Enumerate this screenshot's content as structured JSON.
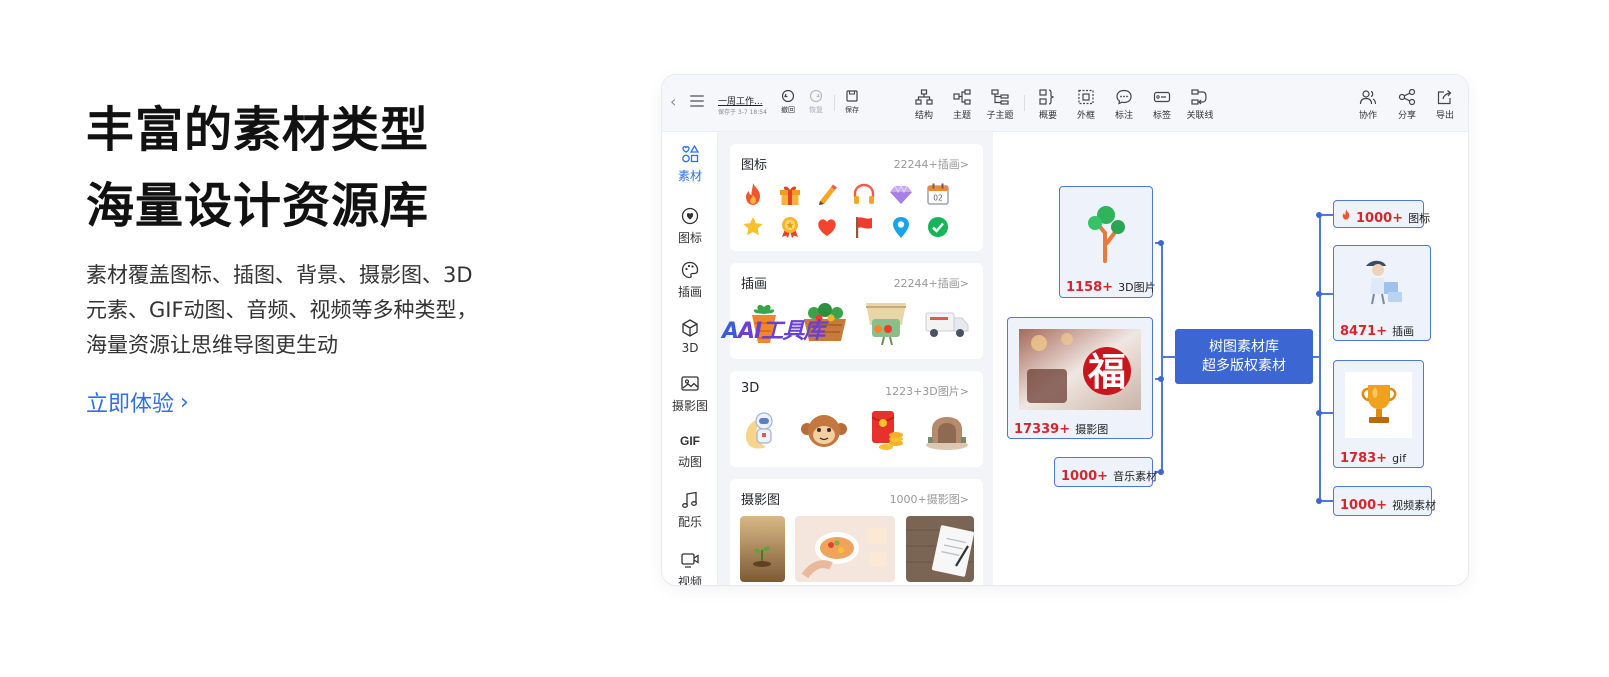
{
  "hero": {
    "title_line1": "丰富的素材类型",
    "title_line2": "海量设计资源库",
    "desc_line1": "素材覆盖图标、插图、背景、摄影图、3D",
    "desc_line2": "元素、GIF动图、音频、视频等多种类型，",
    "desc_line3": "海量资源让思维导图更生动",
    "cta": "立即体验",
    "cta_chevron": "›"
  },
  "toolbar": {
    "doc_title": "一周工作...",
    "doc_saved": "保存于 3-7 18:54",
    "undo": "撤回",
    "redo": "恢复",
    "save": "保存",
    "structure": "结构",
    "topic": "主题",
    "subtopic": "子主题",
    "summary": "概要",
    "frame": "外框",
    "note": "标注",
    "tag": "标签",
    "relation": "关联线",
    "collab": "协作",
    "share": "分享",
    "export": "导出"
  },
  "nav": {
    "material": "素材",
    "icon": "图标",
    "illustration": "插画",
    "three_d": "3D",
    "photo": "摄影图",
    "gif_mark": "GIF",
    "gif": "动图",
    "music": "配乐",
    "video": "视频"
  },
  "panel": {
    "icons_title": "图标",
    "icons_more": "22244+插画>",
    "illus_title": "插画",
    "illus_more": "22244+插画>",
    "three_d_title": "3D",
    "three_d_more": "1223+3D图片>",
    "photo_title": "摄影图",
    "photo_more": "1000+摄影图>",
    "calendar_day": "02"
  },
  "watermark": {
    "a": "A",
    "rest": "AI工具库"
  },
  "mindmap": {
    "center_line1": "树图素材库",
    "center_line2": "超多版权素材",
    "n3d_num": "1158+",
    "n3d_txt": "3D图片",
    "nphoto_num": "17339+",
    "nphoto_txt": "摄影图",
    "photo_glyph": "福",
    "nmusic_num": "1000+",
    "nmusic_txt": "音乐素材",
    "nicon_num": "1000+",
    "nicon_txt": "图标",
    "nillus_num": "8471+",
    "nillus_txt": "插画",
    "ngif_num": "1783+",
    "ngif_txt": "gif",
    "nvideo_num": "1000+",
    "nvideo_txt": "视频素材"
  },
  "colors": {
    "accent": "#2f6fe8",
    "node_border": "#4f79d9",
    "center_node": "#3c67d3",
    "count_red": "#d8252d"
  }
}
